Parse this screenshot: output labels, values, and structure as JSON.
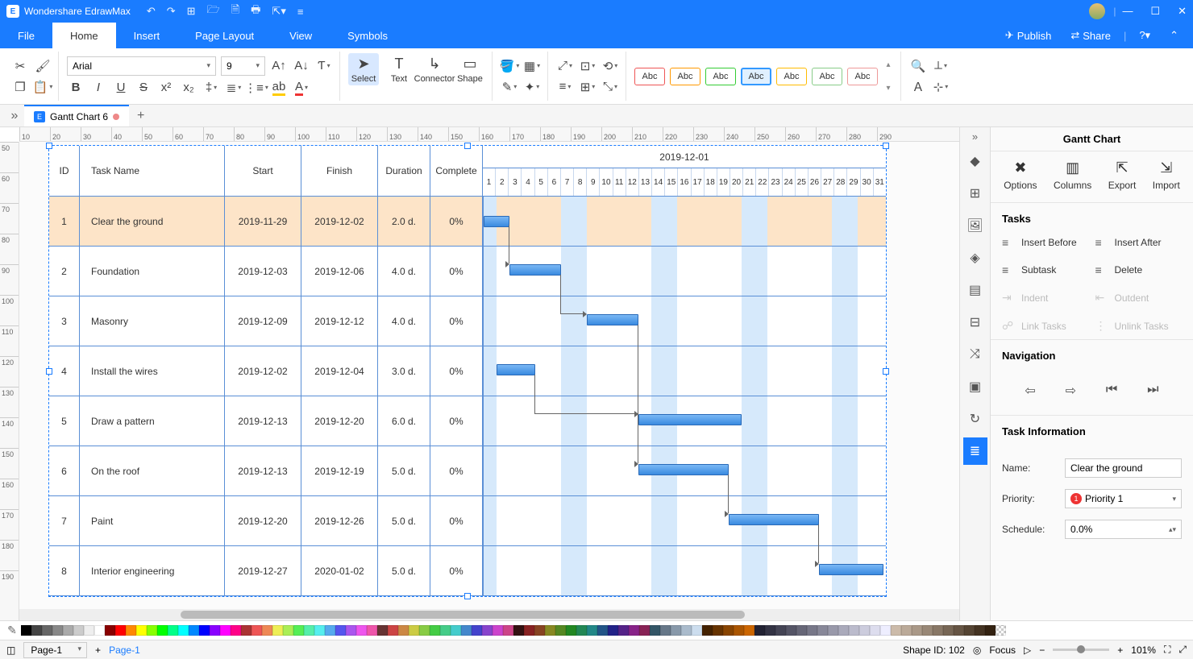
{
  "app": {
    "title": "Wondershare EdrawMax"
  },
  "titlebar": {
    "publish": "Publish",
    "share": "Share"
  },
  "menubar": {
    "tabs": [
      "File",
      "Home",
      "Insert",
      "Page Layout",
      "View",
      "Symbols"
    ],
    "active": 1
  },
  "ribbon": {
    "font": "Arial",
    "size": "9",
    "tools": {
      "select": "Select",
      "text": "Text",
      "connector": "Connector",
      "shape": "Shape"
    },
    "shape_samples": [
      "Abc",
      "Abc",
      "Abc",
      "Abc",
      "Abc",
      "Abc",
      "Abc"
    ],
    "shape_colors": [
      "#e55",
      "#f90",
      "#3c3",
      "#39f",
      "#fb0",
      "#8c8",
      "#e99"
    ]
  },
  "doctab": {
    "name": "Gantt Chart 6"
  },
  "ruler_h": [
    "10",
    "20",
    "30",
    "40",
    "50",
    "60",
    "70",
    "80",
    "90",
    "100",
    "110",
    "120",
    "130",
    "140",
    "150",
    "160",
    "170",
    "180",
    "190",
    "200",
    "210",
    "220",
    "230",
    "240",
    "250",
    "260",
    "270",
    "280",
    "290"
  ],
  "ruler_v": [
    "50",
    "60",
    "70",
    "80",
    "90",
    "100",
    "110",
    "120",
    "130",
    "140",
    "150",
    "160",
    "170",
    "180",
    "190"
  ],
  "gantt": {
    "headers": {
      "id": "ID",
      "task": "Task Name",
      "start": "Start",
      "finish": "Finish",
      "duration": "Duration",
      "complete": "Complete"
    },
    "timeline_month": "2019-12-01",
    "days": 31,
    "weekends": [
      1,
      7,
      8,
      14,
      15,
      21,
      22,
      28,
      29
    ],
    "rows": [
      {
        "id": "1",
        "name": "Clear the ground",
        "start": "2019-11-29",
        "finish": "2019-12-02",
        "dur": "2.0 d.",
        "comp": "0%",
        "bar_from": 0,
        "bar_to": 2,
        "selected": true
      },
      {
        "id": "2",
        "name": "Foundation",
        "start": "2019-12-03",
        "finish": "2019-12-06",
        "dur": "4.0 d.",
        "comp": "0%",
        "bar_from": 2,
        "bar_to": 6
      },
      {
        "id": "3",
        "name": "Masonry",
        "start": "2019-12-09",
        "finish": "2019-12-12",
        "dur": "4.0 d.",
        "comp": "0%",
        "bar_from": 8,
        "bar_to": 12
      },
      {
        "id": "4",
        "name": "Install the wires",
        "start": "2019-12-02",
        "finish": "2019-12-04",
        "dur": "3.0 d.",
        "comp": "0%",
        "bar_from": 1,
        "bar_to": 4
      },
      {
        "id": "5",
        "name": "Draw a pattern",
        "start": "2019-12-13",
        "finish": "2019-12-20",
        "dur": "6.0 d.",
        "comp": "0%",
        "bar_from": 12,
        "bar_to": 20
      },
      {
        "id": "6",
        "name": "On the roof",
        "start": "2019-12-13",
        "finish": "2019-12-19",
        "dur": "5.0 d.",
        "comp": "0%",
        "bar_from": 12,
        "bar_to": 19
      },
      {
        "id": "7",
        "name": "Paint",
        "start": "2019-12-20",
        "finish": "2019-12-26",
        "dur": "5.0 d.",
        "comp": "0%",
        "bar_from": 19,
        "bar_to": 26
      },
      {
        "id": "8",
        "name": "Interior engineering",
        "start": "2019-12-27",
        "finish": "2020-01-02",
        "dur": "5.0 d.",
        "comp": "0%",
        "bar_from": 26,
        "bar_to": 31
      }
    ],
    "deps": [
      {
        "from_row": 0,
        "from_day": 2,
        "to_row": 1,
        "to_day": 2
      },
      {
        "from_row": 1,
        "from_day": 6,
        "to_row": 2,
        "to_day": 8
      },
      {
        "from_row": 2,
        "from_day": 12,
        "to_row": 5,
        "to_day": 12
      },
      {
        "from_row": 3,
        "from_day": 4,
        "to_row": 4,
        "to_day": 12
      },
      {
        "from_row": 5,
        "from_day": 19,
        "to_row": 6,
        "to_day": 19
      },
      {
        "from_row": 6,
        "from_day": 26,
        "to_row": 7,
        "to_day": 26
      }
    ]
  },
  "panel": {
    "title": "Gantt Chart",
    "tools": [
      {
        "label": "Options",
        "icon": "✖"
      },
      {
        "label": "Columns",
        "icon": "▥"
      },
      {
        "label": "Export",
        "icon": "⇱"
      },
      {
        "label": "Import",
        "icon": "⇲"
      }
    ],
    "tasks_title": "Tasks",
    "task_buttons": [
      {
        "label": "Insert Before",
        "icon": "≡",
        "dis": false
      },
      {
        "label": "Insert After",
        "icon": "≡",
        "dis": false
      },
      {
        "label": "Subtask",
        "icon": "≡",
        "dis": false
      },
      {
        "label": "Delete",
        "icon": "≡",
        "dis": false
      },
      {
        "label": "Indent",
        "icon": "⇥",
        "dis": true
      },
      {
        "label": "Outdent",
        "icon": "⇤",
        "dis": true
      },
      {
        "label": "Link Tasks",
        "icon": "☍",
        "dis": true
      },
      {
        "label": "Unlink Tasks",
        "icon": "⋮",
        "dis": true
      }
    ],
    "nav_title": "Navigation",
    "info_title": "Task Information",
    "info": {
      "name_label": "Name:",
      "name_value": "Clear the ground",
      "priority_label": "Priority:",
      "priority_value": "Priority 1",
      "priority_num": "1",
      "schedule_label": "Schedule:",
      "schedule_value": "0.0%"
    }
  },
  "status": {
    "page_sel": "Page-1",
    "page_active": "Page-1",
    "shape_id": "Shape ID: 102",
    "focus": "Focus",
    "zoom": "101%"
  },
  "chart_data": {
    "type": "gantt",
    "title": "Gantt Chart 6",
    "timeline_start": "2019-12-01",
    "timeline_end": "2019-12-31",
    "tasks": [
      {
        "id": 1,
        "name": "Clear the ground",
        "start": "2019-11-29",
        "finish": "2019-12-02",
        "duration_days": 2.0,
        "complete_pct": 0
      },
      {
        "id": 2,
        "name": "Foundation",
        "start": "2019-12-03",
        "finish": "2019-12-06",
        "duration_days": 4.0,
        "complete_pct": 0
      },
      {
        "id": 3,
        "name": "Masonry",
        "start": "2019-12-09",
        "finish": "2019-12-12",
        "duration_days": 4.0,
        "complete_pct": 0
      },
      {
        "id": 4,
        "name": "Install the wires",
        "start": "2019-12-02",
        "finish": "2019-12-04",
        "duration_days": 3.0,
        "complete_pct": 0
      },
      {
        "id": 5,
        "name": "Draw a pattern",
        "start": "2019-12-13",
        "finish": "2019-12-20",
        "duration_days": 6.0,
        "complete_pct": 0
      },
      {
        "id": 6,
        "name": "On the roof",
        "start": "2019-12-13",
        "finish": "2019-12-19",
        "duration_days": 5.0,
        "complete_pct": 0
      },
      {
        "id": 7,
        "name": "Paint",
        "start": "2019-12-20",
        "finish": "2019-12-26",
        "duration_days": 5.0,
        "complete_pct": 0
      },
      {
        "id": 8,
        "name": "Interior engineering",
        "start": "2019-12-27",
        "finish": "2020-01-02",
        "duration_days": 5.0,
        "complete_pct": 0
      }
    ],
    "dependencies": [
      [
        1,
        2
      ],
      [
        2,
        3
      ],
      [
        3,
        6
      ],
      [
        4,
        5
      ],
      [
        6,
        7
      ],
      [
        7,
        8
      ]
    ]
  }
}
